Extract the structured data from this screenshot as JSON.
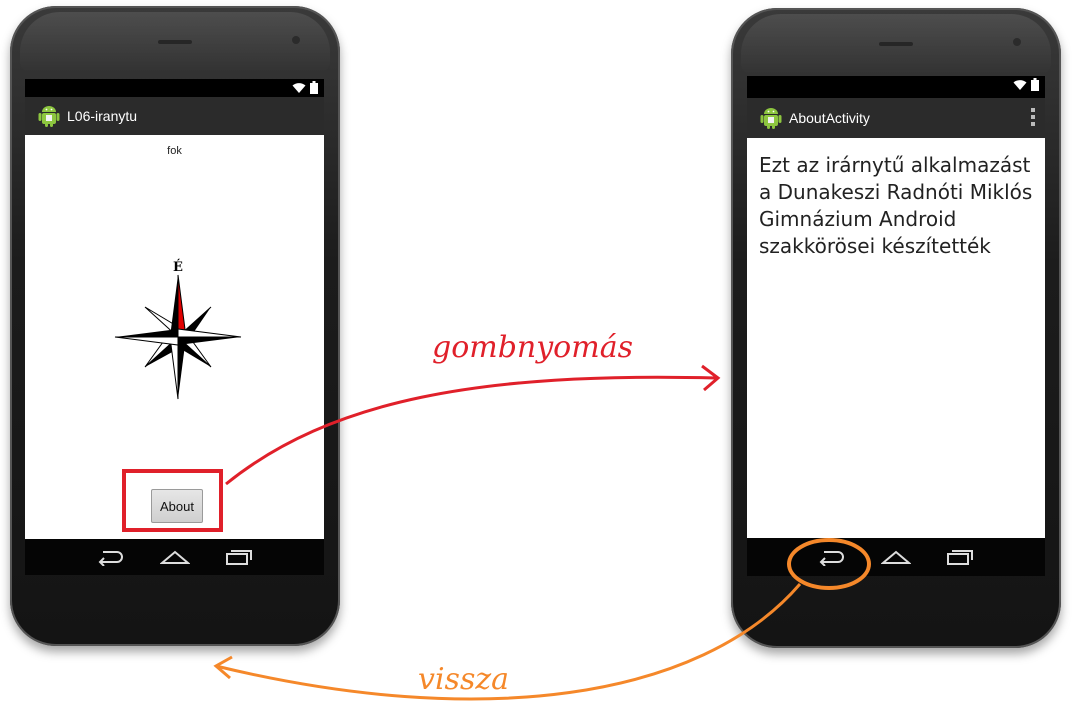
{
  "left_phone": {
    "app_title": "L06-iranytu",
    "fok_label": "fok",
    "compass_north_label": "É",
    "about_button_label": "About"
  },
  "right_phone": {
    "app_title": "AboutActivity",
    "about_text": "Ezt az irárnytű alkalmazást a Dunakeszi Radnóti Miklós Gimnázium Android szakkörösei készítették"
  },
  "annotations": {
    "forward_label": "gombnyomás",
    "back_label": "vissza",
    "forward_color": "#e0202a",
    "back_color": "#f5882a"
  },
  "icons": [
    "android-app-icon",
    "wifi-icon",
    "battery-icon",
    "back-icon",
    "home-icon",
    "recents-icon",
    "overflow-menu-icon",
    "compass-rose-icon"
  ]
}
